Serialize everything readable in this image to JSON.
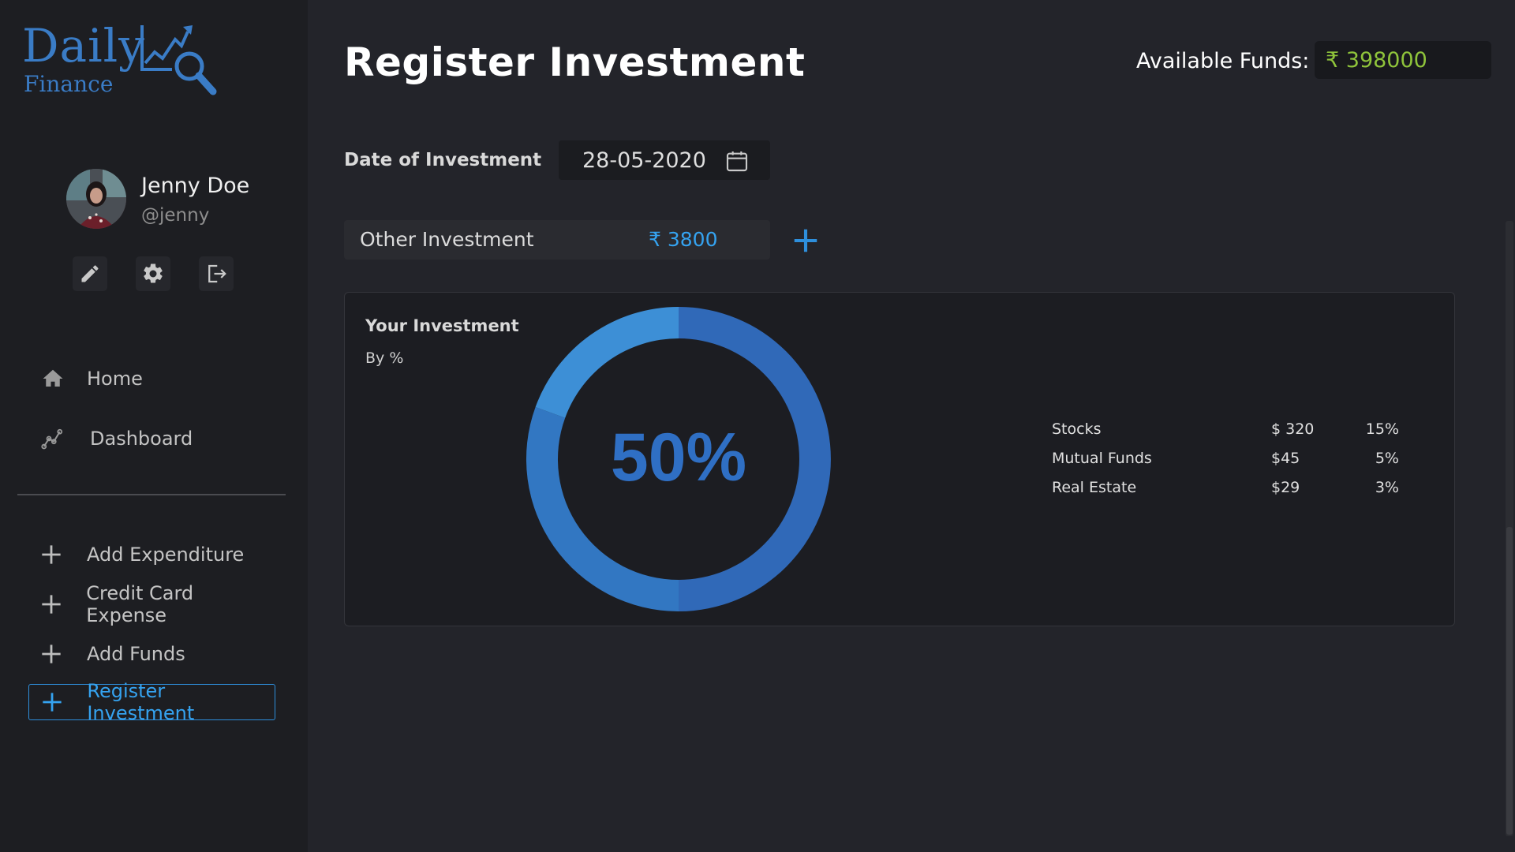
{
  "logo": {
    "primary": "Daily",
    "secondary": "Finance"
  },
  "profile": {
    "name": "Jenny Doe",
    "handle": "@jenny"
  },
  "profile_actions": [
    "edit-icon",
    "gear-icon",
    "logout-icon"
  ],
  "nav": [
    {
      "label": "Home",
      "icon": "home-icon"
    },
    {
      "label": "Dashboard",
      "icon": "chart-line-icon"
    }
  ],
  "actions": [
    {
      "label": "Add Expenditure",
      "icon": "plus-icon",
      "active": false
    },
    {
      "label": "Credit Card Expense",
      "icon": "plus-icon",
      "active": false
    },
    {
      "label": "Add Funds",
      "icon": "plus-icon",
      "active": false
    },
    {
      "label": "Register Investment",
      "icon": "plus-icon",
      "active": true
    }
  ],
  "header": {
    "title": "Register Investment",
    "funds_label": "Available Funds:",
    "funds_value": "₹ 398000"
  },
  "form": {
    "date_label": "Date of Investment",
    "date_value": "28-05-2020",
    "other_label": "Other Investment",
    "other_value": "₹ 3800"
  },
  "investment_card": {
    "title": "Your Investment",
    "subtitle": "By %",
    "center_value": "50%",
    "rows": [
      {
        "name": "Stocks",
        "amount": "$ 320",
        "percent": "15%"
      },
      {
        "name": "Mutual Funds",
        "amount": "$45",
        "percent": "5%"
      },
      {
        "name": "Real Estate",
        "amount": "$29",
        "percent": "3%"
      }
    ]
  },
  "colors": {
    "accent": "#2e8fdc",
    "funds_value": "#8fc43b",
    "donut_dark": "#3069b8",
    "donut_mid": "#3277c2",
    "donut_light": "#3d8fd6",
    "donut_text": "#2f6fc4"
  }
}
